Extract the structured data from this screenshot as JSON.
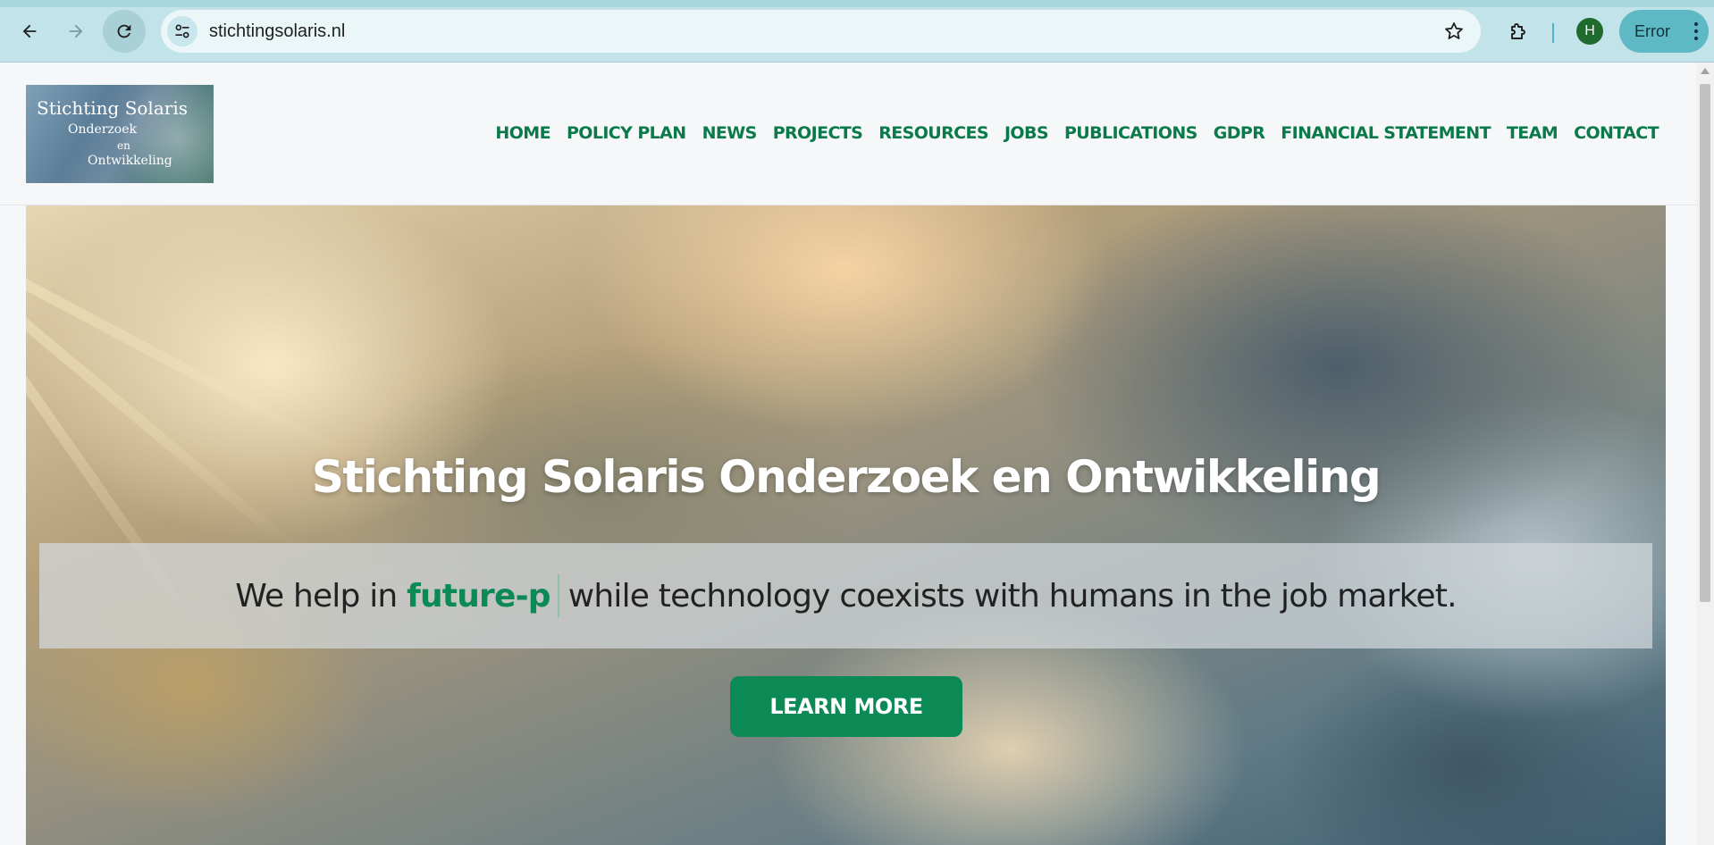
{
  "browser": {
    "url": "stichtingsolaris.nl",
    "profile_initial": "H",
    "error_chip_label": "Error",
    "colors": {
      "chrome": "#c2e3ea",
      "avatar": "#1f6b2d",
      "error_chip": "#5fb9c4"
    }
  },
  "site": {
    "logo": {
      "line1": "Stichting Solaris",
      "line2": "Onderzoek",
      "line3": "en",
      "line4": "Ontwikkeling"
    },
    "nav": [
      {
        "label": "HOME"
      },
      {
        "label": "POLICY PLAN"
      },
      {
        "label": "NEWS"
      },
      {
        "label": "PROJECTS"
      },
      {
        "label": "RESOURCES"
      },
      {
        "label": "JOBS"
      },
      {
        "label": "PUBLICATIONS"
      },
      {
        "label": "GDPR"
      },
      {
        "label": "FINANCIAL STATEMENT"
      },
      {
        "label": "TEAM"
      },
      {
        "label": "CONTACT"
      }
    ],
    "colors": {
      "brand_green": "#0b7a4a",
      "button_green": "#0b8a55"
    }
  },
  "hero": {
    "title": "Stichting Solaris Onderzoek en Ontwikkeling",
    "tagline_prefix": "We help in",
    "tagline_typed": "future-p",
    "tagline_suffix": "while technology coexists with humans in the job market.",
    "cta_label": "LEARN MORE"
  },
  "icons": {
    "back": "arrow-left-icon",
    "forward": "arrow-right-icon",
    "reload": "reload-icon",
    "site_info": "tune-icon",
    "bookmark": "star-icon",
    "extensions": "puzzle-icon",
    "menu": "kebab-icon"
  }
}
